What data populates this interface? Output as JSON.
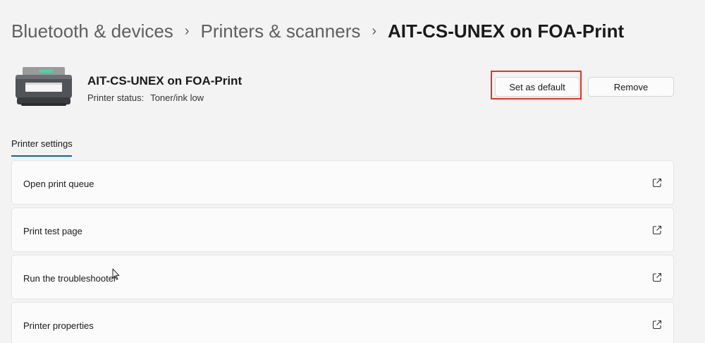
{
  "breadcrumb": {
    "items": [
      "Bluetooth & devices",
      "Printers & scanners"
    ],
    "current": "AIT-CS-UNEX on FOA-Print",
    "separator": "›"
  },
  "printer": {
    "name": "AIT-CS-UNEX on FOA-Print",
    "status_label": "Printer status:",
    "status_value": "Toner/ink low",
    "icon": "printer-icon"
  },
  "actions": {
    "set_default_label": "Set as default",
    "remove_label": "Remove",
    "highlight_color": "#e8331c"
  },
  "section": {
    "title": "Printer settings",
    "accent_color": "#0067c0"
  },
  "settings": [
    {
      "label": "Open print queue",
      "icon": "external-link-icon"
    },
    {
      "label": "Print test page",
      "icon": "external-link-icon"
    },
    {
      "label": "Run the troubleshooter",
      "icon": "external-link-icon"
    },
    {
      "label": "Printer properties",
      "icon": "external-link-icon"
    }
  ]
}
